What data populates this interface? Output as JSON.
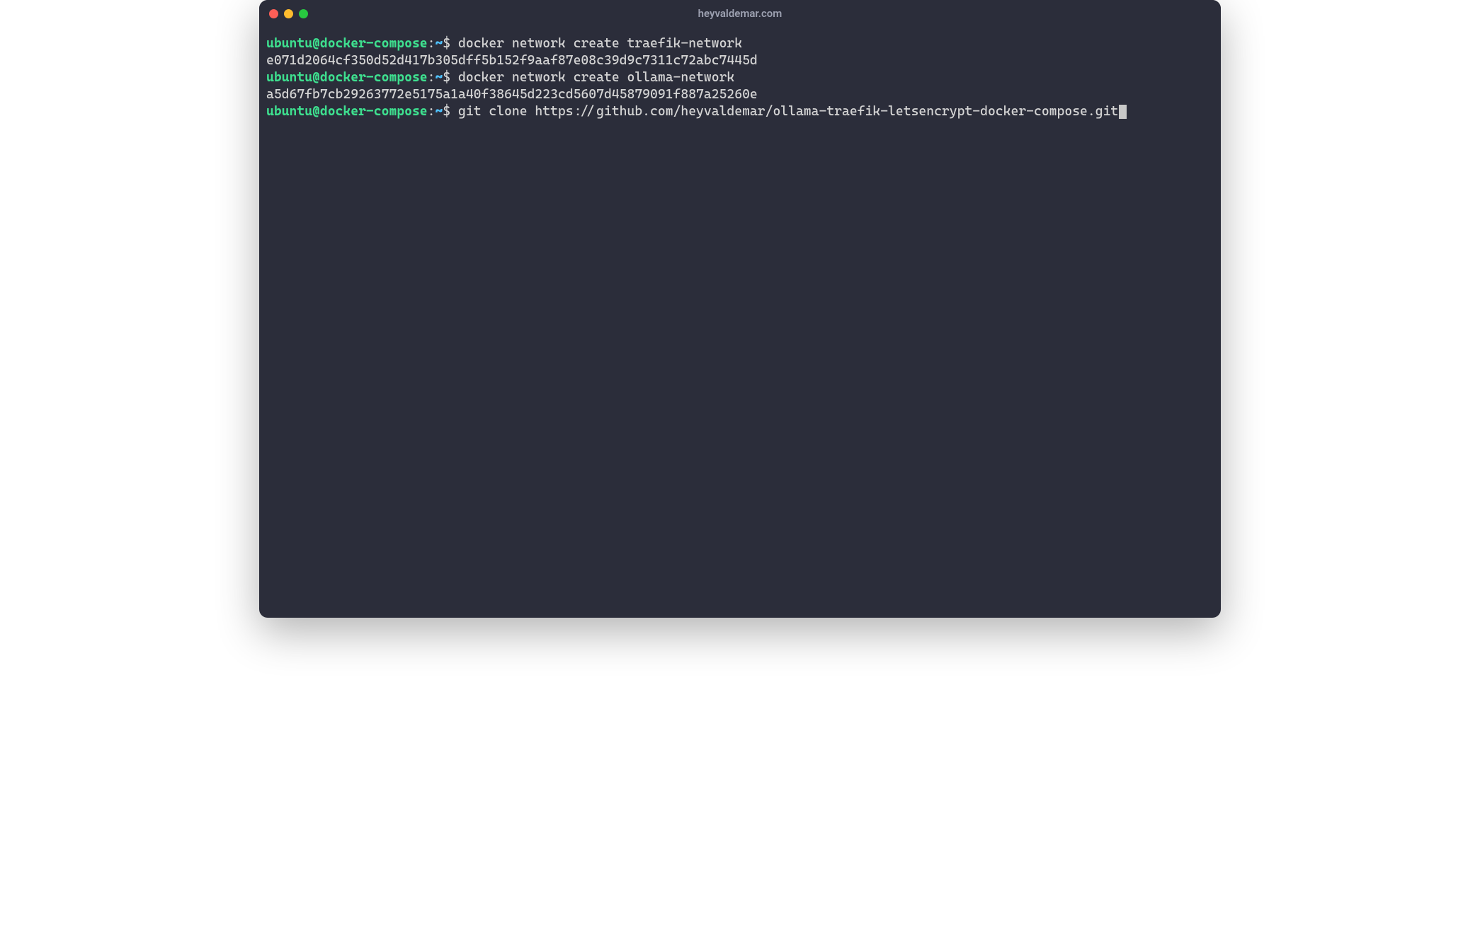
{
  "window": {
    "title": "heyvaldemar.com"
  },
  "prompt": {
    "user_host": "ubuntu@docker-compose",
    "separator": ":",
    "path": "~",
    "symbol": "$"
  },
  "lines": {
    "cmd1": "docker network create traefik-network",
    "out1": "e071d2064cf350d52d417b305dff5b152f9aaf87e08c39d9c7311c72abc7445d",
    "cmd2": "docker network create ollama-network",
    "out2": "a5d67fb7cb29263772e5175a1a40f38645d223cd5607d45879091f887a25260e",
    "cmd3": "git clone https://github.com/heyvaldemar/ollama-traefik-letsencrypt-docker-compose.git"
  },
  "colors": {
    "bg": "#2b2d3a",
    "prompt_user": "#3ee08f",
    "prompt_path": "#4fc1ff",
    "text": "#d4d4d4"
  }
}
